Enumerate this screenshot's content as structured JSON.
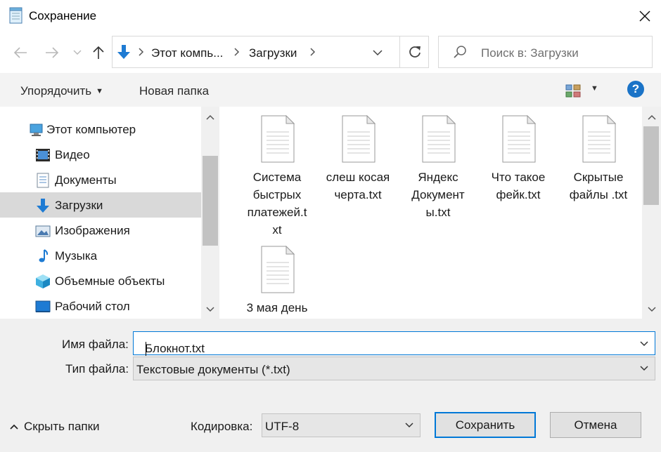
{
  "window": {
    "title": "Сохранение",
    "title_icon": "notepad-icon",
    "close_icon": "close-icon"
  },
  "nav": {
    "back_icon": "arrow-left-icon",
    "forward_icon": "arrow-right-icon",
    "recent_icon": "chevron-down-icon",
    "up_icon": "arrow-up-icon",
    "address": {
      "crumbs": [
        "Этот компь...",
        "Загрузки"
      ],
      "refresh_icon": "refresh-icon",
      "location_icon": "download-icon"
    },
    "search_placeholder": "Поиск в: Загрузки"
  },
  "toolbar": {
    "organize": "Упорядочить",
    "new_folder": "Новая папка",
    "view_icon": "view-options-icon",
    "help": "?"
  },
  "sidebar": {
    "items": [
      {
        "label": "Этот компьютер",
        "icon": "computer-icon",
        "selected": false
      },
      {
        "label": "Видео",
        "icon": "video-icon",
        "selected": false
      },
      {
        "label": "Документы",
        "icon": "documents-icon",
        "selected": false
      },
      {
        "label": "Загрузки",
        "icon": "downloads-icon",
        "selected": true
      },
      {
        "label": "Изображения",
        "icon": "pictures-icon",
        "selected": false
      },
      {
        "label": "Музыка",
        "icon": "music-icon",
        "selected": false
      },
      {
        "label": "Объемные объекты",
        "icon": "3d-objects-icon",
        "selected": false
      },
      {
        "label": "Рабочий стол",
        "icon": "desktop-icon",
        "selected": false
      }
    ]
  },
  "files": [
    {
      "name": "Система быстрых платежей.txt",
      "lines": [
        "Система",
        "быстрых",
        "платежей.t",
        "xt"
      ]
    },
    {
      "name": "слеш косая черта.txt",
      "lines": [
        "слеш косая",
        "черта.txt"
      ]
    },
    {
      "name": "Яндекс Документы.txt",
      "lines": [
        "Яндекс",
        "Документ",
        "ы.txt"
      ]
    },
    {
      "name": "Что такое фейк.txt",
      "lines": [
        "Что такое",
        "фейк.txt"
      ]
    },
    {
      "name": "Скрытые файлы .txt",
      "lines": [
        "Скрытые",
        "файлы .txt"
      ]
    },
    {
      "name": "3 мая день",
      "lines": [
        "3 мая день"
      ]
    }
  ],
  "form": {
    "filename_label": "Имя файла:",
    "filename_value": "Блокнот.txt",
    "filetype_label": "Тип файла:",
    "filetype_value": "Текстовые документы (*.txt)",
    "encoding_label": "Кодировка:",
    "encoding_value": "UTF-8"
  },
  "footer": {
    "hide_folders": "Скрыть папки",
    "save": "Сохранить",
    "cancel": "Отмена"
  },
  "colors": {
    "accent": "#0078d7",
    "selected": "#d9d9d9",
    "toolbar_bg": "#f3f3f3",
    "bottom_bg": "#f0f0f0"
  }
}
